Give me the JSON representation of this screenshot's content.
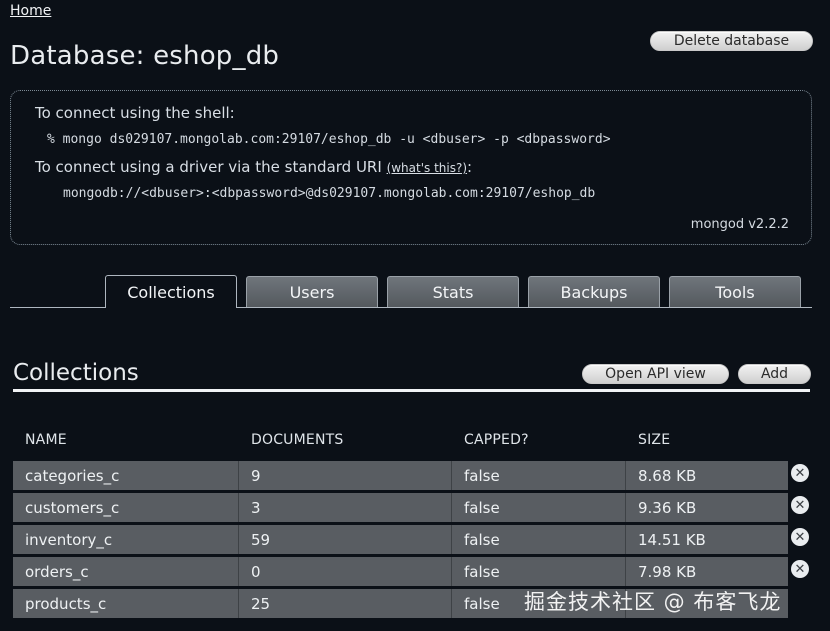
{
  "nav": {
    "home": "Home"
  },
  "page": {
    "title": "Database: eshop_db",
    "delete_label": "Delete database"
  },
  "connect": {
    "shell_label": "To connect using the shell:",
    "shell_command": "% mongo ds029107.mongolab.com:29107/eshop_db -u <dbuser> -p <dbpassword>",
    "driver_label_before": "To connect using a driver via the standard URI ",
    "whats_this": "(what's this?)",
    "driver_label_after": ":",
    "uri": "mongodb://<dbuser>:<dbpassword>@ds029107.mongolab.com:29107/eshop_db",
    "mongod_version": "mongod v2.2.2"
  },
  "tabs": [
    {
      "label": "Collections",
      "active": true
    },
    {
      "label": "Users",
      "active": false
    },
    {
      "label": "Stats",
      "active": false
    },
    {
      "label": "Backups",
      "active": false
    },
    {
      "label": "Tools",
      "active": false
    }
  ],
  "collections": {
    "title": "Collections",
    "api_label": "Open API view",
    "add_label": "Add",
    "headers": [
      "NAME",
      "DOCUMENTS",
      "CAPPED?",
      "SIZE"
    ],
    "rows": [
      {
        "name": "categories_c",
        "documents": "9",
        "capped": "false",
        "size": "8.68 KB"
      },
      {
        "name": "customers_c",
        "documents": "3",
        "capped": "false",
        "size": "9.36 KB"
      },
      {
        "name": "inventory_c",
        "documents": "59",
        "capped": "false",
        "size": "14.51 KB"
      },
      {
        "name": "orders_c",
        "documents": "0",
        "capped": "false",
        "size": "7.98 KB"
      },
      {
        "name": "products_c",
        "documents": "25",
        "capped": "false",
        "size": ""
      }
    ],
    "delete_glyph": "✕"
  },
  "watermark": "掘金技术社区 @ 布客飞龙"
}
